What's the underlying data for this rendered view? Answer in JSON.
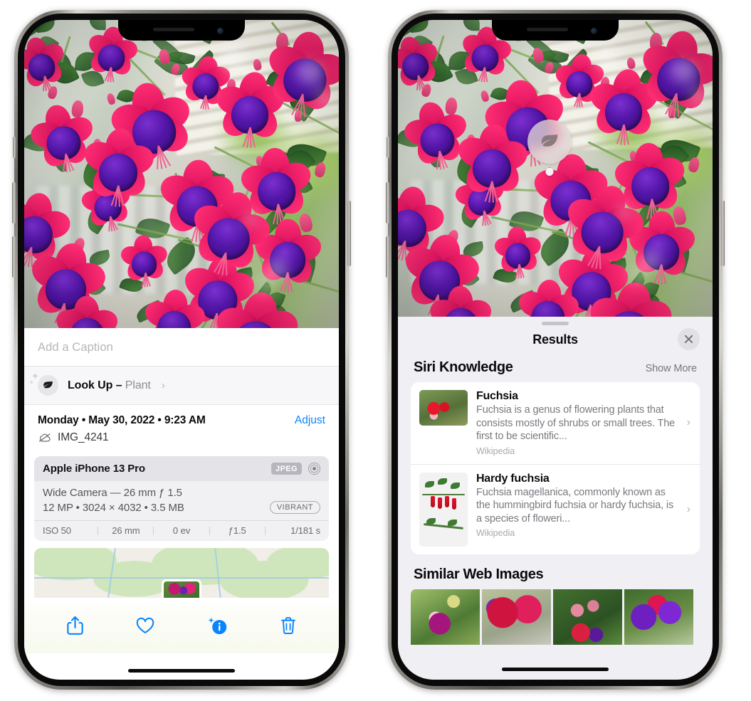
{
  "left_phone": {
    "photo": {
      "alt": "fuchsia-flowers-photo"
    },
    "caption": {
      "placeholder": "Add a Caption",
      "value": ""
    },
    "lookup": {
      "icon": "leaf-icon",
      "sparkle_icon": "sparkles-icon",
      "label": "Look Up – ",
      "subject": "Plant",
      "chevron": "›"
    },
    "date": {
      "text": "Monday • May 30, 2022 • 9:23 AM",
      "adjust_label": "Adjust",
      "cloud_icon": "cloud-slash-icon",
      "filename": "IMG_4241"
    },
    "metadata": {
      "device": "Apple iPhone 13 Pro",
      "format_badge": "JPEG",
      "aperture_icon": "aperture-icon",
      "lens_line": "Wide Camera — 26 mm ƒ 1.5",
      "size_line": "12 MP • 3024 × 4032 • 3.5 MB",
      "style_badge": "VIBRANT",
      "exif": [
        "ISO 50",
        "26 mm",
        "0 ev",
        "ƒ1.5",
        "1/181 s"
      ]
    },
    "map": {
      "label": "photo-location-map"
    },
    "toolbar": {
      "share_icon": "share-icon",
      "favorite_icon": "heart-icon",
      "info_icon": "info-sparkle-icon",
      "delete_icon": "trash-icon",
      "accent_color": "#0b84ff"
    }
  },
  "right_phone": {
    "photo": {
      "alt": "fuchsia-flowers-photo"
    },
    "visual_lookup_badge": {
      "icon": "leaf-icon"
    },
    "sheet": {
      "title": "Results",
      "close_icon": "close-icon",
      "siri_knowledge": {
        "heading": "Siri Knowledge",
        "show_more": "Show More",
        "results": [
          {
            "title": "Fuchsia",
            "description": "Fuchsia is a genus of flowering plants that consists mostly of shrubs or small trees. The first to be scientific...",
            "source": "Wikipedia",
            "chevron": "›"
          },
          {
            "title": "Hardy fuchsia",
            "description": "Fuchsia magellanica, commonly known as the hummingbird fuchsia or hardy fuchsia, is a species of floweri...",
            "source": "Wikipedia",
            "chevron": "›"
          }
        ]
      },
      "similar_web_images": {
        "heading": "Similar Web Images",
        "thumbnails": [
          "web-image-1",
          "web-image-2",
          "web-image-3",
          "web-image-4"
        ]
      }
    }
  }
}
